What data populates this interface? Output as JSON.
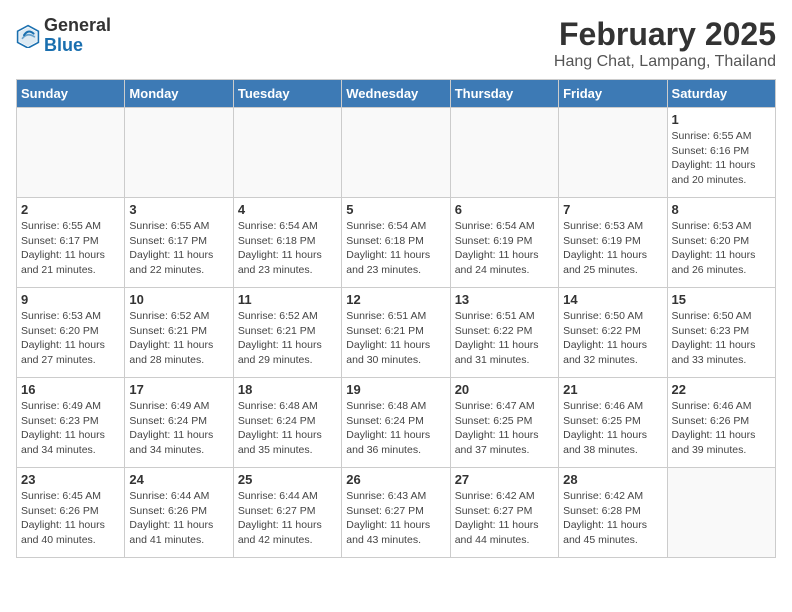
{
  "header": {
    "logo_general": "General",
    "logo_blue": "Blue",
    "month_year": "February 2025",
    "location": "Hang Chat, Lampang, Thailand"
  },
  "weekdays": [
    "Sunday",
    "Monday",
    "Tuesday",
    "Wednesday",
    "Thursday",
    "Friday",
    "Saturday"
  ],
  "weeks": [
    [
      {
        "day": "",
        "info": ""
      },
      {
        "day": "",
        "info": ""
      },
      {
        "day": "",
        "info": ""
      },
      {
        "day": "",
        "info": ""
      },
      {
        "day": "",
        "info": ""
      },
      {
        "day": "",
        "info": ""
      },
      {
        "day": "1",
        "info": "Sunrise: 6:55 AM\nSunset: 6:16 PM\nDaylight: 11 hours\nand 20 minutes."
      }
    ],
    [
      {
        "day": "2",
        "info": "Sunrise: 6:55 AM\nSunset: 6:17 PM\nDaylight: 11 hours\nand 21 minutes."
      },
      {
        "day": "3",
        "info": "Sunrise: 6:55 AM\nSunset: 6:17 PM\nDaylight: 11 hours\nand 22 minutes."
      },
      {
        "day": "4",
        "info": "Sunrise: 6:54 AM\nSunset: 6:18 PM\nDaylight: 11 hours\nand 23 minutes."
      },
      {
        "day": "5",
        "info": "Sunrise: 6:54 AM\nSunset: 6:18 PM\nDaylight: 11 hours\nand 23 minutes."
      },
      {
        "day": "6",
        "info": "Sunrise: 6:54 AM\nSunset: 6:19 PM\nDaylight: 11 hours\nand 24 minutes."
      },
      {
        "day": "7",
        "info": "Sunrise: 6:53 AM\nSunset: 6:19 PM\nDaylight: 11 hours\nand 25 minutes."
      },
      {
        "day": "8",
        "info": "Sunrise: 6:53 AM\nSunset: 6:20 PM\nDaylight: 11 hours\nand 26 minutes."
      }
    ],
    [
      {
        "day": "9",
        "info": "Sunrise: 6:53 AM\nSunset: 6:20 PM\nDaylight: 11 hours\nand 27 minutes."
      },
      {
        "day": "10",
        "info": "Sunrise: 6:52 AM\nSunset: 6:21 PM\nDaylight: 11 hours\nand 28 minutes."
      },
      {
        "day": "11",
        "info": "Sunrise: 6:52 AM\nSunset: 6:21 PM\nDaylight: 11 hours\nand 29 minutes."
      },
      {
        "day": "12",
        "info": "Sunrise: 6:51 AM\nSunset: 6:21 PM\nDaylight: 11 hours\nand 30 minutes."
      },
      {
        "day": "13",
        "info": "Sunrise: 6:51 AM\nSunset: 6:22 PM\nDaylight: 11 hours\nand 31 minutes."
      },
      {
        "day": "14",
        "info": "Sunrise: 6:50 AM\nSunset: 6:22 PM\nDaylight: 11 hours\nand 32 minutes."
      },
      {
        "day": "15",
        "info": "Sunrise: 6:50 AM\nSunset: 6:23 PM\nDaylight: 11 hours\nand 33 minutes."
      }
    ],
    [
      {
        "day": "16",
        "info": "Sunrise: 6:49 AM\nSunset: 6:23 PM\nDaylight: 11 hours\nand 34 minutes."
      },
      {
        "day": "17",
        "info": "Sunrise: 6:49 AM\nSunset: 6:24 PM\nDaylight: 11 hours\nand 34 minutes."
      },
      {
        "day": "18",
        "info": "Sunrise: 6:48 AM\nSunset: 6:24 PM\nDaylight: 11 hours\nand 35 minutes."
      },
      {
        "day": "19",
        "info": "Sunrise: 6:48 AM\nSunset: 6:24 PM\nDaylight: 11 hours\nand 36 minutes."
      },
      {
        "day": "20",
        "info": "Sunrise: 6:47 AM\nSunset: 6:25 PM\nDaylight: 11 hours\nand 37 minutes."
      },
      {
        "day": "21",
        "info": "Sunrise: 6:46 AM\nSunset: 6:25 PM\nDaylight: 11 hours\nand 38 minutes."
      },
      {
        "day": "22",
        "info": "Sunrise: 6:46 AM\nSunset: 6:26 PM\nDaylight: 11 hours\nand 39 minutes."
      }
    ],
    [
      {
        "day": "23",
        "info": "Sunrise: 6:45 AM\nSunset: 6:26 PM\nDaylight: 11 hours\nand 40 minutes."
      },
      {
        "day": "24",
        "info": "Sunrise: 6:44 AM\nSunset: 6:26 PM\nDaylight: 11 hours\nand 41 minutes."
      },
      {
        "day": "25",
        "info": "Sunrise: 6:44 AM\nSunset: 6:27 PM\nDaylight: 11 hours\nand 42 minutes."
      },
      {
        "day": "26",
        "info": "Sunrise: 6:43 AM\nSunset: 6:27 PM\nDaylight: 11 hours\nand 43 minutes."
      },
      {
        "day": "27",
        "info": "Sunrise: 6:42 AM\nSunset: 6:27 PM\nDaylight: 11 hours\nand 44 minutes."
      },
      {
        "day": "28",
        "info": "Sunrise: 6:42 AM\nSunset: 6:28 PM\nDaylight: 11 hours\nand 45 minutes."
      },
      {
        "day": "",
        "info": ""
      }
    ]
  ]
}
